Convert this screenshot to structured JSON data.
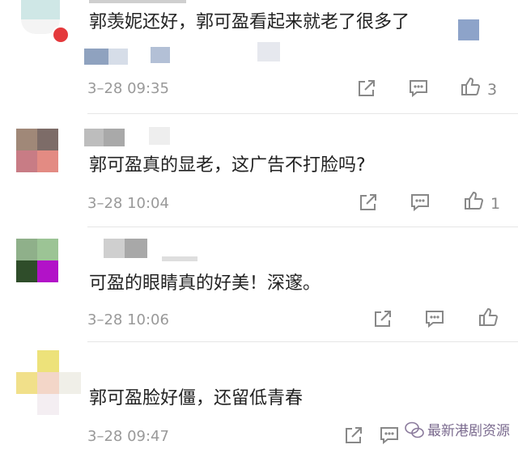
{
  "comments": [
    {
      "text": "郭羡妮还好，郭可盈看起来就老了很多了",
      "time": "3–28 09:35",
      "likes": "3"
    },
    {
      "text": "郭可盈真的显老，这广告不打脸吗?",
      "time": "3–28 10:04",
      "likes": "1"
    },
    {
      "text": "可盈的眼睛真的好美！深邃。",
      "time": "3–28 10:06",
      "likes": ""
    },
    {
      "text": "郭可盈脸好僵，还留低青春",
      "time": "3–28 09:47",
      "likes": ""
    }
  ],
  "icons": {
    "share": "share-icon",
    "reply": "reply-icon",
    "like": "thumbs-up-icon",
    "badge": "red-badge-icon"
  },
  "watermark": {
    "text": "最新港剧资源"
  },
  "colors": {
    "text": "#222222",
    "meta": "#999999",
    "divider": "#e6e6e6",
    "badge": "#e4393c"
  }
}
